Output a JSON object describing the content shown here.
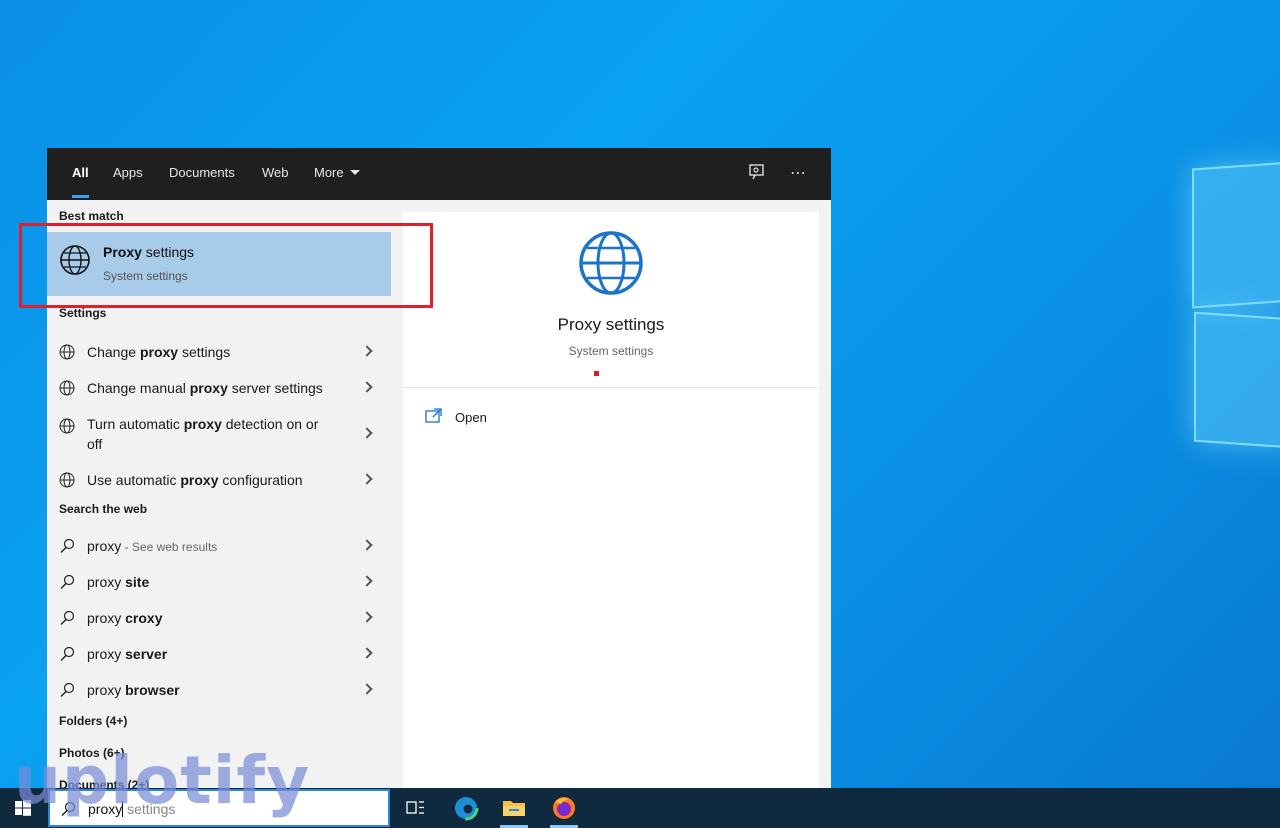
{
  "tabs": [
    {
      "label": "All",
      "active": true
    },
    {
      "label": "Apps"
    },
    {
      "label": "Documents"
    },
    {
      "label": "Web"
    },
    {
      "label": "More"
    }
  ],
  "best_match": {
    "section": "Best match",
    "title_bold": "Proxy",
    "title_rest": " settings",
    "subtitle": "System settings"
  },
  "settings": {
    "section": "Settings",
    "items": [
      {
        "pre": "Change ",
        "bold": "proxy",
        "post": " settings"
      },
      {
        "pre": "Change manual ",
        "bold": "proxy",
        "post": " server settings"
      },
      {
        "pre": "Turn automatic ",
        "bold": "proxy",
        "post": " detection on or off"
      },
      {
        "pre": "Use automatic ",
        "bold": "proxy",
        "post": " configuration"
      }
    ]
  },
  "web": {
    "section": "Search the web",
    "first": {
      "text": "proxy",
      "hint": " - See web results"
    },
    "items": [
      {
        "pre": "proxy ",
        "bold": "site"
      },
      {
        "pre": "proxy ",
        "bold": "croxy"
      },
      {
        "pre": "proxy ",
        "bold": "server"
      },
      {
        "pre": "proxy ",
        "bold": "browser"
      }
    ]
  },
  "more_sections": [
    "Folders (4+)",
    "Photos (6+)",
    "Documents (2+)"
  ],
  "preview": {
    "title": "Proxy settings",
    "subtitle": "System settings",
    "open_label": "Open"
  },
  "search": {
    "typed": "proxy",
    "suggestion": " settings"
  },
  "watermark": "uplotify",
  "colors": {
    "accent": "#3aa0f3",
    "highlight": "#a8cbea",
    "red_box": "#e0202a"
  }
}
